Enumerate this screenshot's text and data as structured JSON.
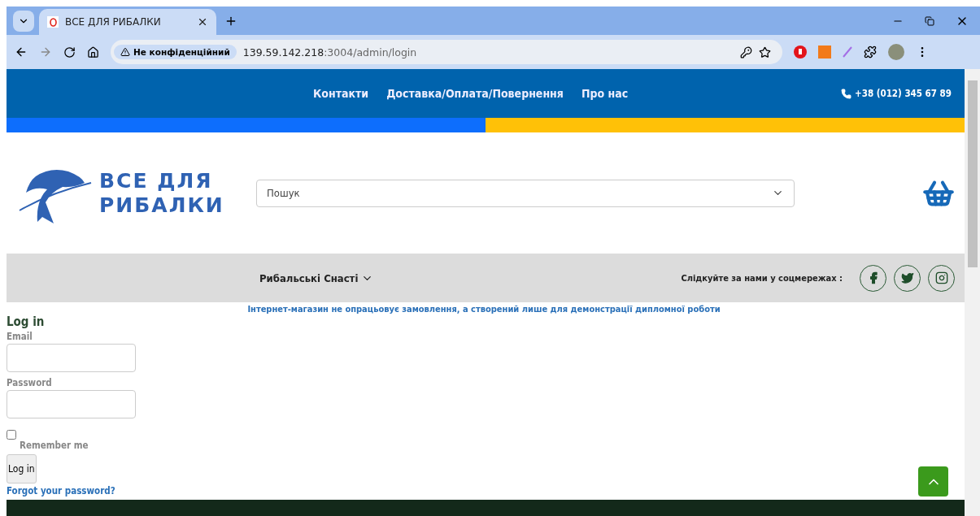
{
  "browser": {
    "tab_title": "ВСЕ ДЛЯ РИБАЛКИ",
    "security_label": "Не конфіденційний",
    "url_host": "139.59.142.218",
    "url_path": ":3004/admin/login"
  },
  "top_nav": {
    "links": [
      "Контакти",
      "Доставка/Оплата/Повернення",
      "Про нас"
    ],
    "phone": "+38 (012) 345 67 89"
  },
  "logo": {
    "line1": "ВСЕ ДЛЯ",
    "line2": "РИБАЛКИ"
  },
  "search": {
    "placeholder": "Пошук"
  },
  "category_nav": {
    "menu": "Рибальські Снасті",
    "social_label": "Слідкуйте за нами у соцмережах :"
  },
  "notice": "Інтернет-магазин не опрацьовує замовлення, а створений лише для демонстрації дипломної роботи",
  "login": {
    "title": "Log in",
    "email_label": "Email",
    "password_label": "Password",
    "remember_label": "Remember me",
    "remember_checked": false,
    "submit": "Log in",
    "forgot": "Forgot your password?"
  }
}
